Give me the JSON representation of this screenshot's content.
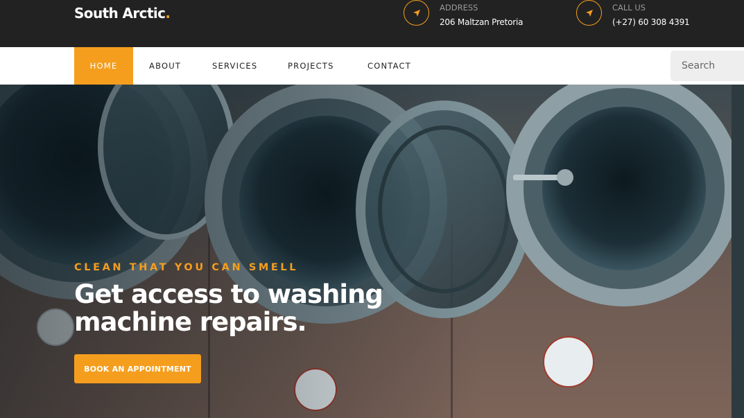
{
  "brand": {
    "name": "South Arctic",
    "dot": "."
  },
  "topbar": {
    "address": {
      "label": "ADDRESS",
      "value": "206 Maltzan Pretoria",
      "icon": "location-arrow-icon"
    },
    "call": {
      "label": "CALL US",
      "value": "(+27) 60 308 4391",
      "icon": "location-arrow-icon"
    }
  },
  "nav": {
    "items": [
      {
        "label": "HOME",
        "active": true
      },
      {
        "label": "ABOUT",
        "active": false
      },
      {
        "label": "SERVICES",
        "active": false
      },
      {
        "label": "PROJECTS",
        "active": false
      },
      {
        "label": "CONTACT",
        "active": false
      }
    ],
    "search": {
      "placeholder": "Search",
      "value": ""
    }
  },
  "hero": {
    "kicker": "CLEAN THAT YOU CAN SMELL",
    "headline": "Get access to washing machine repairs.",
    "cta_label": "BOOK AN APPOINTMENT",
    "image": "washing-machines-photo"
  },
  "colors": {
    "accent": "#f59e1e",
    "topbar": "#222222",
    "nav_bg": "#ffffff"
  }
}
